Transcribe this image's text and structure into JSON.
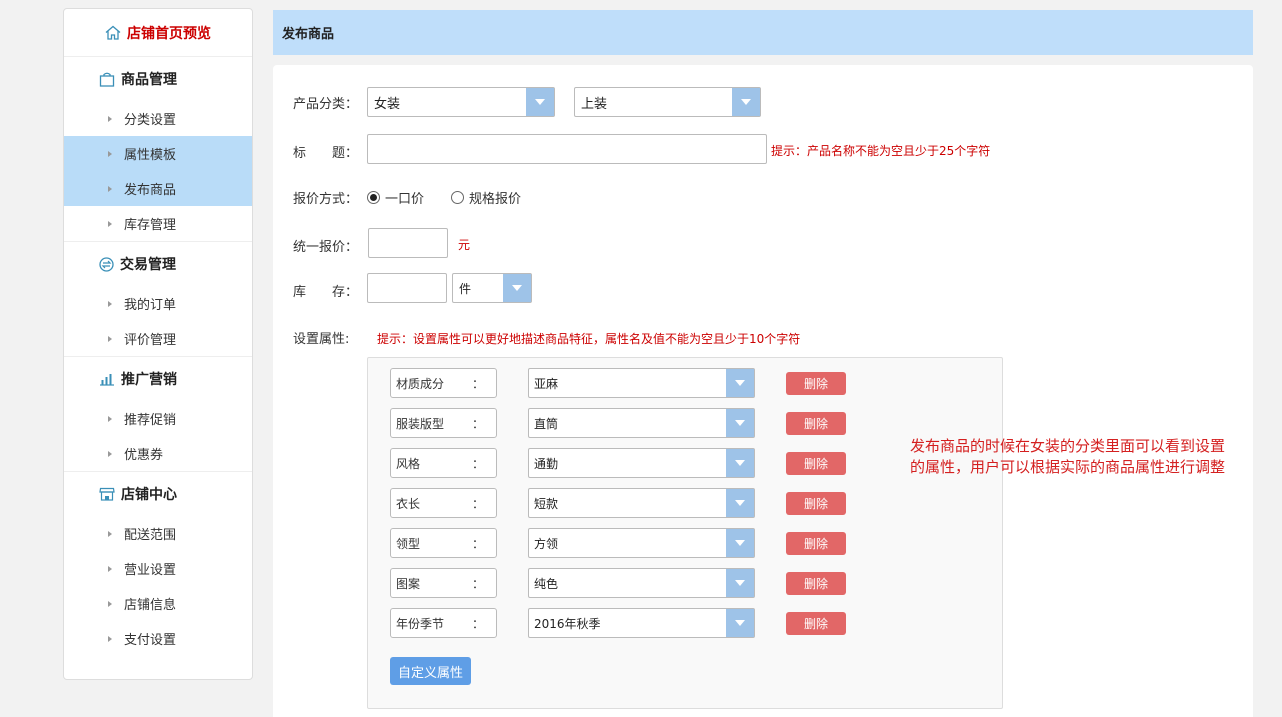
{
  "sidebar": {
    "home": "店铺首页预览",
    "sections": [
      {
        "title": "商品管理",
        "icon": "bag-icon",
        "items": [
          {
            "label": "分类设置",
            "active": false
          },
          {
            "label": "属性模板",
            "active": true
          },
          {
            "label": "发布商品",
            "active": true
          },
          {
            "label": "库存管理",
            "active": false
          }
        ]
      },
      {
        "title": "交易管理",
        "icon": "exchange-icon",
        "items": [
          {
            "label": "我的订单",
            "active": false
          },
          {
            "label": "评价管理",
            "active": false
          }
        ]
      },
      {
        "title": "推广营销",
        "icon": "bar-chart-icon",
        "items": [
          {
            "label": "推荐促销",
            "active": false
          },
          {
            "label": "优惠券",
            "active": false
          }
        ]
      },
      {
        "title": "店铺中心",
        "icon": "store-icon",
        "items": [
          {
            "label": "配送范围",
            "active": false
          },
          {
            "label": "营业设置",
            "active": false
          },
          {
            "label": "店铺信息",
            "active": false
          },
          {
            "label": "支付设置",
            "active": false
          }
        ]
      }
    ]
  },
  "header": {
    "title": "发布商品"
  },
  "form": {
    "category_label": "产品分类：",
    "category1": "女装",
    "category2": "上装",
    "title_label": "标　　题：",
    "title_value": "",
    "title_hint": "提示：产品名称不能为空且少于25个字符",
    "price_mode_label": "报价方式：",
    "price_mode_options": [
      "一口价",
      "规格报价"
    ],
    "price_mode_selected": 0,
    "unified_price_label": "统一报价：",
    "unified_price_value": "",
    "price_unit": "元",
    "stock_label": "库　　存：",
    "stock_value": "",
    "stock_unit": "件",
    "attr_label": "设置属性:",
    "attr_hint": "提示：设置属性可以更好地描述商品特征，属性名及值不能为空且少于10个字符",
    "attributes": [
      {
        "name": "材质成分",
        "value": "亚麻"
      },
      {
        "name": "服装版型",
        "value": "直筒"
      },
      {
        "name": "风格",
        "value": "通勤"
      },
      {
        "name": "衣长",
        "value": "短款"
      },
      {
        "name": "领型",
        "value": "方领"
      },
      {
        "name": "图案",
        "value": "纯色"
      },
      {
        "name": "年份季节",
        "value": "2016年秋季"
      }
    ],
    "colon": "：",
    "delete_label": "删除",
    "custom_attr_label": "自定义属性"
  },
  "note": "发布商品的时候在女装的分类里面可以看到设置的属性，用户可以根据实际的商品属性进行调整",
  "colors": {
    "accent": "#bfdefa",
    "active": "#b9dcf8",
    "danger": "#e26767",
    "primary": "#5f9ee6",
    "hint": "#cc0000"
  }
}
